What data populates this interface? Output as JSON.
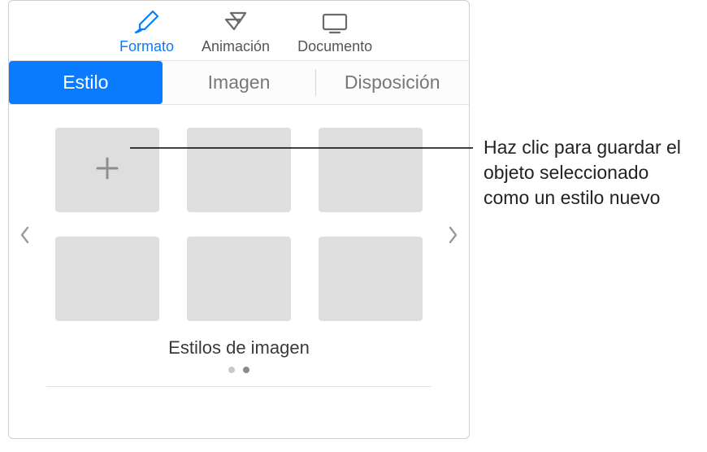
{
  "toolbar": {
    "items": [
      {
        "label": "Formato",
        "icon": "paintbrush-icon",
        "active": true
      },
      {
        "label": "Animación",
        "icon": "diamond-icon",
        "active": false
      },
      {
        "label": "Documento",
        "icon": "screen-icon",
        "active": false
      }
    ]
  },
  "segmented": {
    "tabs": [
      {
        "label": "Estilo",
        "active": true
      },
      {
        "label": "Imagen",
        "active": false
      },
      {
        "label": "Disposición",
        "active": false
      }
    ]
  },
  "styles": {
    "section_title": "Estilos de imagen",
    "grid_positions": 6,
    "add_position": 0,
    "page_count": 2,
    "active_page": 1
  },
  "callout": {
    "text": "Haz clic para guardar el objeto seleccionado como un estilo nuevo"
  }
}
